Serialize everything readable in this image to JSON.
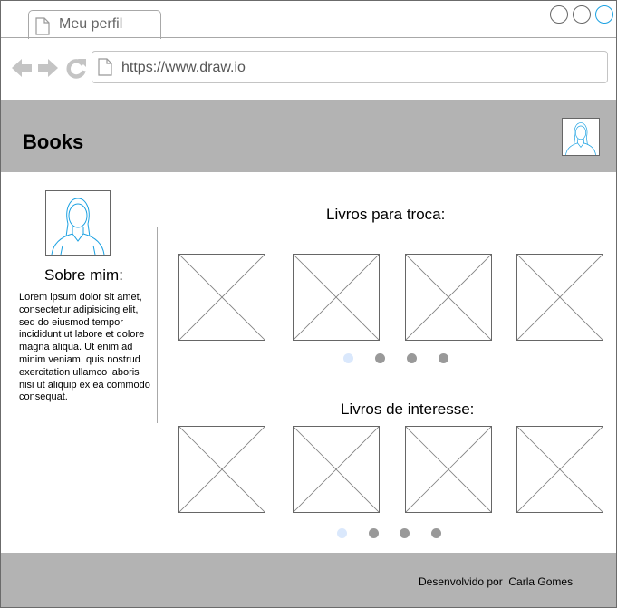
{
  "browser": {
    "tab_title": "Meu perfil",
    "url": "https://www.draw.io",
    "window_controls": [
      "minimize",
      "maximize",
      "close"
    ]
  },
  "header": {
    "brand": "Books",
    "avatar_icon": "user-avatar-icon"
  },
  "profile": {
    "about_title": "Sobre mim:",
    "about_text": "Lorem ipsum dolor sit amet, consectetur adipisicing elit, sed do eiusmod tempor incididunt ut labore et dolore magna aliqua. Ut enim ad minim veniam, quis nostrud exercitation ullamco laboris nisi ut aliquip ex ea commodo consequat."
  },
  "sections": {
    "trade": {
      "title": "Livros para troca:",
      "book_count": 4,
      "carousel_pages": 4,
      "active_page": 1
    },
    "interest": {
      "title": "Livros de interesse:",
      "book_count": 4,
      "carousel_pages": 4,
      "active_page": 1
    }
  },
  "footer": {
    "credits": "Desenvolvido por  Carla Gomes"
  },
  "colors": {
    "header_bg": "#b3b3b3",
    "footer_bg": "#b3b3b3",
    "dot_active": "#dae8fc",
    "dot_inactive": "#999999",
    "avatar_line": "#1ba1e2",
    "window_close": "#1ba1e2"
  }
}
